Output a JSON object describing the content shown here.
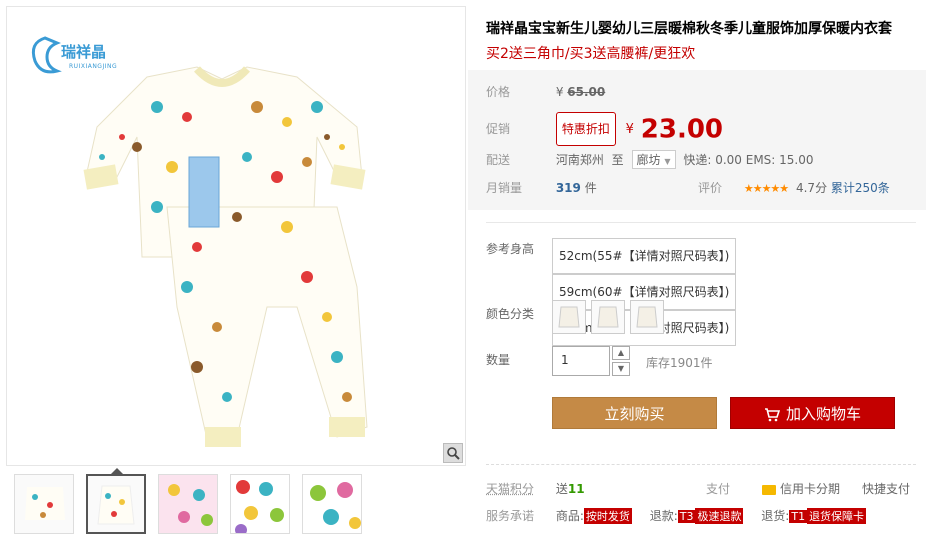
{
  "product": {
    "title": "瑞祥晶宝宝新生儿婴幼儿三层暖棉秋冬季儿童服饰加厚保暖内衣套",
    "subtitle": "买2送三角巾/买3送高腰裤/更狂欢",
    "brand_logo_text": "瑞祥晶",
    "brand_logo_sub": "RUIXIANGJING"
  },
  "price": {
    "label": "价格",
    "currency": "¥",
    "original": "65.00",
    "promo_label": "促销",
    "promo_tag": "特惠折扣",
    "current": "23.00"
  },
  "shipping": {
    "label": "配送",
    "from": "河南郑州",
    "to_word": "至",
    "destination": "廊坊",
    "fees": "快递: 0.00 EMS: 15.00"
  },
  "sales": {
    "label": "月销量",
    "count": "319",
    "unit": "件",
    "rating_label": "评价",
    "stars": "★★★★★",
    "score": "4.7分",
    "reviews": "累计250条"
  },
  "sku": {
    "size_label": "参考身高",
    "sizes": [
      "52cm(55#【详情对照尺码表】)",
      "59cm(60#【详情对照尺码表】)",
      "66cm(65#【详情对照尺码表】)"
    ],
    "color_label": "颜色分类",
    "qty_label": "数量",
    "qty_value": "1",
    "stock": "库存1901件"
  },
  "actions": {
    "buy_now": "立刻购买",
    "add_cart": "加入购物车",
    "cart_icon": "shopping-cart-icon"
  },
  "footer": {
    "points_label": "天猫积分",
    "points_prefix": "送",
    "points_value": "11",
    "pay_label": "支付",
    "credit": "信用卡分期",
    "quickpay": "快捷支付",
    "promise_label": "服务承诺",
    "goods_prefix": "商品:",
    "goods_badge": "按时发货",
    "refund_prefix": "退款:",
    "refund_tag": "T3",
    "refund_badge": "极速退款",
    "return_prefix": "退货:",
    "return_tag": "T1",
    "return_badge": "退货保障卡"
  },
  "colors": {
    "accent_red": "#c40000",
    "buy_button": "#c58a46",
    "link_blue": "#336699"
  }
}
